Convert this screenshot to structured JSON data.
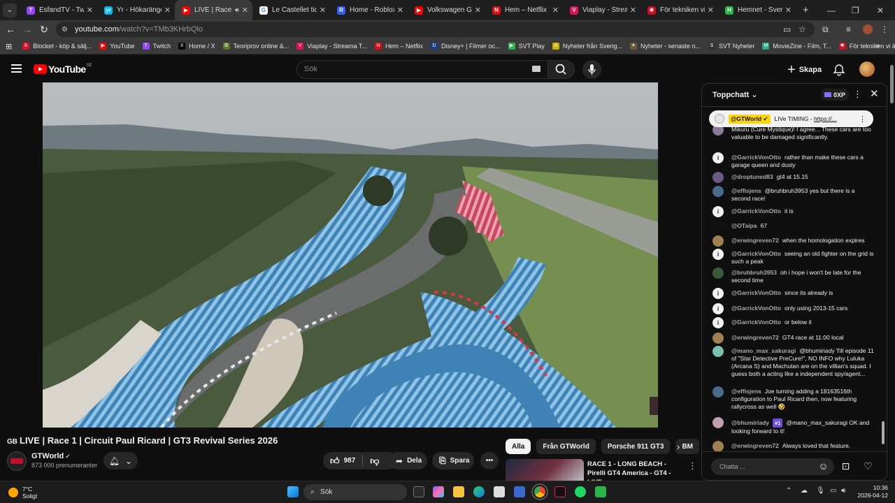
{
  "browser": {
    "tabs": [
      {
        "title": "EsfandTV - Twitch",
        "color": "#9146ff",
        "glyph": "T",
        "active": false
      },
      {
        "title": "Yr - Hökarängen",
        "color": "#00b9f1",
        "glyph": "yr",
        "active": false
      },
      {
        "title": "LIVE | Race 1",
        "color": "#ff0000",
        "glyph": "▶",
        "active": true
      },
      {
        "title": "Le Castellet tid - Sw",
        "color": "#ffffff",
        "glyph": "G",
        "active": false
      },
      {
        "title": "Home - Roblox",
        "color": "#335fff",
        "glyph": "R",
        "active": false
      },
      {
        "title": "Volkswagen Golf -",
        "color": "#ff0000",
        "glyph": "▶",
        "active": false
      },
      {
        "title": "Hem – Netflix",
        "color": "#e50914",
        "glyph": "N",
        "active": false
      },
      {
        "title": "Viaplay - Streama",
        "color": "#e0105a",
        "glyph": "V",
        "active": false
      },
      {
        "title": "För tekniken vi älsk",
        "color": "#d01020",
        "glyph": "✱",
        "active": false
      },
      {
        "title": "Hemnet - Sverige",
        "color": "#2bb34a",
        "glyph": "H",
        "active": false
      }
    ],
    "new_tab_label": "+",
    "url_host": "youtube.com",
    "url_path": "/watch?v=TMb3KHrbQlo",
    "bookmarks": [
      {
        "label": "Blocket - köp & sälj...",
        "color": "#e01020",
        "glyph": "b"
      },
      {
        "label": "YouTube",
        "color": "#ff0000",
        "glyph": "▶"
      },
      {
        "label": "Twitch",
        "color": "#9146ff",
        "glyph": "T"
      },
      {
        "label": "Home / X",
        "color": "#000000",
        "glyph": "X"
      },
      {
        "label": "Teoriprov online &...",
        "color": "#5a7a2a",
        "glyph": "⚙"
      },
      {
        "label": "Viaplay - Streama T...",
        "color": "#e0105a",
        "glyph": "V"
      },
      {
        "label": "Hem – Netflix",
        "color": "#e50914",
        "glyph": "N"
      },
      {
        "label": "Disney+ | Filmer oc...",
        "color": "#1a3a8a",
        "glyph": "D"
      },
      {
        "label": "SVT Play",
        "color": "#2bb34a",
        "glyph": "▶"
      },
      {
        "label": "Nyheter från Sverig...",
        "color": "#d0b000",
        "glyph": "A"
      },
      {
        "label": "Nyheter - senaste n...",
        "color": "#6a5a3a",
        "glyph": "✦"
      },
      {
        "label": "SVT Nyheter",
        "color": "#333333",
        "glyph": "S"
      },
      {
        "label": "MovieZine - Film, T...",
        "color": "#2aaa8a",
        "glyph": "M"
      },
      {
        "label": "För tekniken vi älska...",
        "color": "#d01020",
        "glyph": "✱"
      }
    ]
  },
  "youtube": {
    "logo_text": "YouTube",
    "region": "SE",
    "search_placeholder": "Sök",
    "create_label": "Skapa"
  },
  "video": {
    "title": "LIVE | Race 1 | Circuit Paul Ricard | GT3 Revival Series 2026",
    "channel": "GTWorld",
    "subscribers": "873 000 prenumeranter",
    "likes": "987",
    "share_label": "Dela",
    "save_label": "Spara"
  },
  "sidebar": {
    "chips": [
      "Alla",
      "Från GTWorld",
      "Porsche 911 GT3",
      "BM"
    ],
    "recommendation_title": "RACE 1 - LONG BEACH - Pirelli GT4 America - GT4 - LIVE"
  },
  "chat": {
    "title": "Toppchatt",
    "xp": "0XP",
    "pinned_author": "@GTWorld",
    "pinned_text": "LIVe TIMING - ",
    "pinned_link": "https://...",
    "input_placeholder": "Chatta ...",
    "messages": [
      {
        "author": "",
        "badge": "",
        "text": "Mikuru (Cure Mystique)! I agree... These cars are too valuable to be damaged significantly.",
        "avatar": "#8a7a9a",
        "icon": ""
      },
      {
        "author": "@GarrickVonOtto",
        "badge": "",
        "text": "rather than make these cars a garage queen and dusty",
        "avatar": "info",
        "icon": "i"
      },
      {
        "author": "@droptuned83",
        "badge": "",
        "text": "gt4 at 15.15",
        "avatar": "#6a5a8a",
        "icon": ""
      },
      {
        "author": "@effisjens",
        "badge": "",
        "text": "@bruhbruh3953 yes but there is a second race!",
        "avatar": "#4a6a8a",
        "icon": ""
      },
      {
        "author": "@GarrickVonOtto",
        "badge": "",
        "text": "it is",
        "avatar": "info",
        "icon": "i"
      },
      {
        "author": "@OTaipa",
        "badge": "",
        "text": "67",
        "avatar": "#111111",
        "icon": ""
      },
      {
        "author": "@erwingreven72",
        "badge": "",
        "text": "when the homologation expires",
        "avatar": "#a08050",
        "icon": ""
      },
      {
        "author": "@GarrickVonOtto",
        "badge": "",
        "text": "seeing an old fighter on the grid is such a peak",
        "avatar": "info",
        "icon": "i"
      },
      {
        "author": "@bruhbruh3953",
        "badge": "",
        "text": "oh i hope i won't be late for the second time",
        "avatar": "#3a5a3a",
        "icon": ""
      },
      {
        "author": "@GarrickVonOtto",
        "badge": "",
        "text": "since its already is",
        "avatar": "info",
        "icon": "i"
      },
      {
        "author": "@GarrickVonOtto",
        "badge": "",
        "text": "only using 2013-15 cars",
        "avatar": "info",
        "icon": "i"
      },
      {
        "author": "@GarrickVonOtto",
        "badge": "",
        "text": "or below it",
        "avatar": "info",
        "icon": "i"
      },
      {
        "author": "@erwingreven72",
        "badge": "",
        "text": "GT4 race at 11:00 local",
        "avatar": "#a08050",
        "icon": ""
      },
      {
        "author": "@mano_max_sakuragi",
        "badge": "",
        "text": "@bhumiriady Till episode 11 of \"Star Detective PreCure!\", NO INFO why Luluka (Arcana S) and Machutan are on the villian's squad. I guess both a acting like a independent spy/agent...",
        "avatar": "#7ac0b0",
        "icon": ""
      },
      {
        "author": "@effisjens",
        "badge": "",
        "text": "Joe turning adding a 18163516th configuration to Paul Ricard then, now featuring rallycross as well 🤣",
        "avatar": "#4a6a8a",
        "icon": ""
      },
      {
        "author": "@bhumiriady",
        "badge": "#1",
        "text": "@mano_max_sakuragi OK and looking forward to it!",
        "avatar": "#c0a0b0",
        "icon": ""
      },
      {
        "author": "@erwingreven72",
        "badge": "",
        "text": "Always loved that feature.",
        "avatar": "#a08050",
        "icon": ""
      }
    ]
  },
  "taskbar": {
    "temp": "7°C",
    "weather": "Soligt",
    "search_label": "Sök",
    "time": "10:36",
    "date": "2026-04-12"
  }
}
